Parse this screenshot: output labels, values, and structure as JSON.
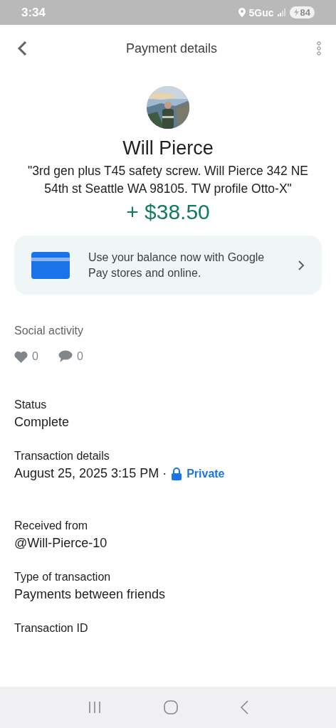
{
  "status_bar": {
    "time": "3:34",
    "network": "5Guc",
    "battery": "84"
  },
  "header": {
    "title": "Payment details"
  },
  "payment": {
    "name": "Will Pierce",
    "note": "\"3rd gen plus T45 safety screw. Will Pierce 342 NE 54th st Seattle WA 98105. TW profile Otto-X\"",
    "amount": "+ $38.50"
  },
  "promo": {
    "text": "Use your balance now with Google Pay stores and online."
  },
  "social": {
    "title": "Social activity",
    "likes": "0",
    "comments": "0"
  },
  "details": [
    {
      "kind": "plain",
      "label": "Status",
      "value": "Complete"
    },
    {
      "kind": "privacy",
      "label": "Transaction details",
      "value": "August 25, 2025 3:15 PM ·",
      "privacy": "Private"
    },
    {
      "kind": "plain",
      "label": "Received from",
      "value": "@Will-Pierce-10"
    },
    {
      "kind": "plain",
      "label": "Type of transaction",
      "value": "Payments between friends"
    },
    {
      "kind": "label_only",
      "label": "Transaction ID"
    }
  ]
}
